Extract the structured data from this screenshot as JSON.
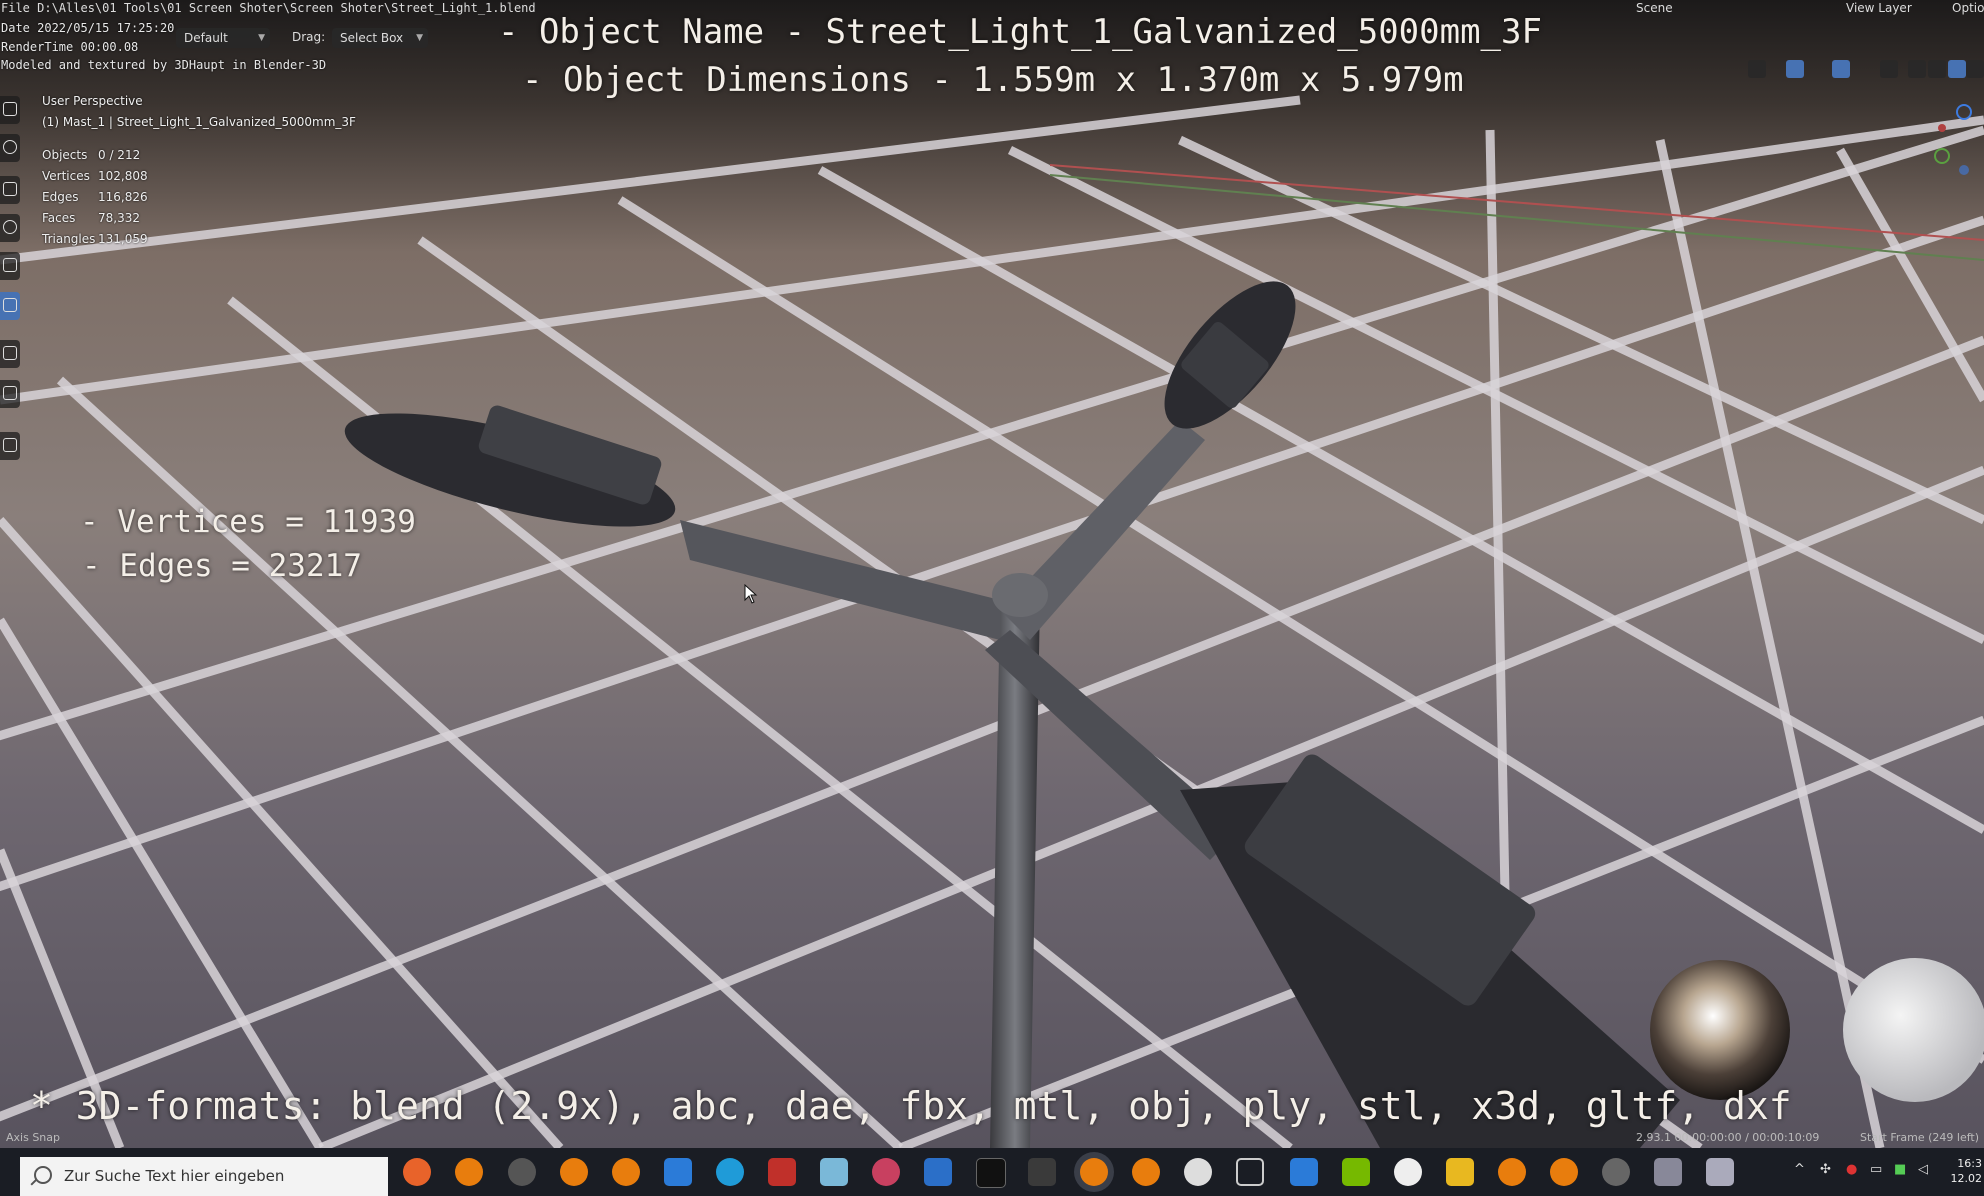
{
  "menubar": {
    "file_path": "File D:\\Alles\\01 Tools\\01 Screen Shoter\\Screen Shoter\\Street_Light_1.blend",
    "scene_label": "Scene",
    "view_layer_label": "View Layer",
    "options_label": "Options"
  },
  "stamps": {
    "date": "Date 2022/05/15 17:25:20",
    "render_time": "RenderTime 00:00.08",
    "credit": "Modeled and textured by 3DHaupt in Blender-3D"
  },
  "header": {
    "transform_orientation": "Default",
    "drag_label": "Drag:",
    "drag_value": "Select Box"
  },
  "overlay": {
    "object_name": "- Object Name - Street_Light_1_Galvanized_5000mm_3F",
    "object_dimensions": "- Object Dimensions -  1.559m x 1.370m x 5.979m",
    "vertices": "- Vertices = 11939",
    "edges": "- Edges = 23217",
    "formats": "* 3D-formats: blend (2.9x), abc, dae, fbx, mtl, obj, ply, stl, x3d, gltf, dxf"
  },
  "viewport_info": {
    "perspective": "User Perspective",
    "active_object": "(1) Mast_1 | Street_Light_1_Galvanized_5000mm_3F",
    "stats": [
      {
        "label": "Objects",
        "value": "0 / 212"
      },
      {
        "label": "Vertices",
        "value": "102,808"
      },
      {
        "label": "Edges",
        "value": "116,826"
      },
      {
        "label": "Faces",
        "value": "78,332"
      },
      {
        "label": "Triangles",
        "value": "131,059"
      }
    ]
  },
  "statusbar": {
    "left": "Axis Snap",
    "version_time": "2.93.1  00:00:00:00 / 00:00:10:09",
    "start_frame": "Start Frame (249 left)"
  },
  "taskbar": {
    "search_placeholder": "Zur Suche Text hier eingeben",
    "clock_time": "16:3",
    "clock_date": "12.02"
  },
  "colors": {
    "accent": "#4772b3",
    "overlay_text": "#f4efe8",
    "taskbar_bg": "#1a1d24"
  }
}
